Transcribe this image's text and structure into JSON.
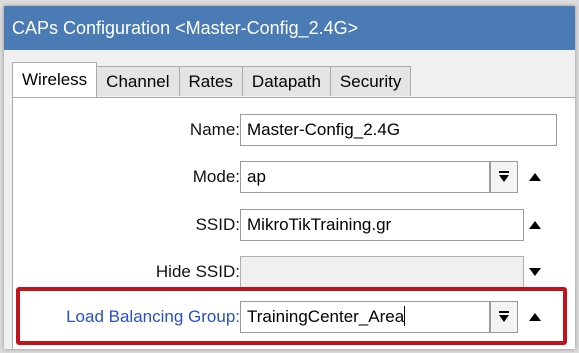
{
  "window": {
    "title": "CAPs Configuration <Master-Config_2.4G>"
  },
  "tabs": [
    {
      "label": "Wireless",
      "active": true
    },
    {
      "label": "Channel",
      "active": false
    },
    {
      "label": "Rates",
      "active": false
    },
    {
      "label": "Datapath",
      "active": false
    },
    {
      "label": "Security",
      "active": false
    }
  ],
  "form": {
    "name": {
      "label": "Name:",
      "value": "Master-Config_2.4G"
    },
    "mode": {
      "label": "Mode:",
      "value": "ap"
    },
    "ssid": {
      "label": "SSID:",
      "value": "MikroTikTraining.gr"
    },
    "hide_ssid": {
      "label": "Hide SSID:",
      "value": ""
    },
    "load_balancing_group": {
      "label": "Load Balancing Group:",
      "value": "TrainingCenter_Area"
    }
  },
  "icons": {
    "dropdown": "dropdown-icon",
    "collapse": "triangle-up-icon",
    "expand": "triangle-down-icon"
  },
  "colors": {
    "titlebar": "#4a7bb5",
    "highlight": "#c0141c",
    "label_link": "#2b4fc7"
  }
}
